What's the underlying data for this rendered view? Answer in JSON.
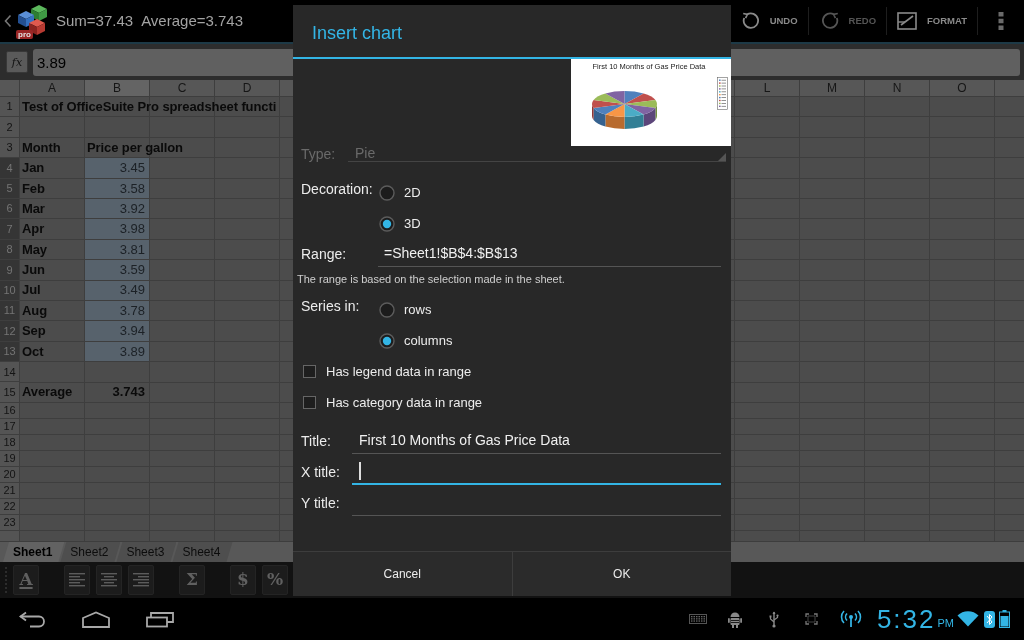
{
  "action_bar": {
    "logo_badge": "pro",
    "sum": "Sum=37.43",
    "average": "Average=3.743",
    "actions": [
      {
        "kind": "undo",
        "label": "UNDO",
        "disabled": false
      },
      {
        "kind": "redo",
        "label": "REDO",
        "disabled": true
      },
      {
        "kind": "format",
        "label": "FORMAT",
        "disabled": false
      }
    ]
  },
  "formula_bar": {
    "function_button": "fx",
    "value": "3.89"
  },
  "sheet": {
    "columns_left": [
      {
        "label": "A",
        "selected": false
      },
      {
        "label": "B",
        "selected": true
      },
      {
        "label": "C",
        "selected": false
      },
      {
        "label": "D",
        "selected": false
      }
    ],
    "columns_right": [
      {
        "label": "L",
        "selected": false
      },
      {
        "label": "M",
        "selected": false
      },
      {
        "label": "N",
        "selected": false
      },
      {
        "label": "O",
        "selected": false
      }
    ],
    "rows": [
      {
        "number": "1",
        "selected": false,
        "cells": [
          {
            "kind": "label",
            "text": "Test of OfficeSuite Pro spreadsheet functi"
          }
        ]
      },
      {
        "number": "2",
        "selected": false
      },
      {
        "number": "3",
        "selected": false,
        "cells": [
          {
            "kind": "label",
            "text": "Month"
          },
          {
            "kind": "label",
            "text": "Price per gallon"
          }
        ]
      },
      {
        "number": "4",
        "selected": true,
        "cells": [
          {
            "kind": "label",
            "text": "Jan"
          },
          {
            "kind": "value",
            "text": "3.45"
          }
        ]
      },
      {
        "number": "5",
        "selected": true,
        "cells": [
          {
            "kind": "label",
            "text": "Feb"
          },
          {
            "kind": "value",
            "text": "3.58"
          }
        ]
      },
      {
        "number": "6",
        "selected": true,
        "cells": [
          {
            "kind": "label",
            "text": "Mar"
          },
          {
            "kind": "value",
            "text": "3.92"
          }
        ]
      },
      {
        "number": "7",
        "selected": true,
        "cells": [
          {
            "kind": "label",
            "text": "Apr"
          },
          {
            "kind": "value",
            "text": "3.98"
          }
        ]
      },
      {
        "number": "8",
        "selected": true,
        "cells": [
          {
            "kind": "label",
            "text": "May"
          },
          {
            "kind": "value",
            "text": "3.81"
          }
        ]
      },
      {
        "number": "9",
        "selected": true,
        "cells": [
          {
            "kind": "label",
            "text": "Jun"
          },
          {
            "kind": "value",
            "text": "3.59"
          }
        ]
      },
      {
        "number": "10",
        "selected": true,
        "cells": [
          {
            "kind": "label",
            "text": "Jul"
          },
          {
            "kind": "value",
            "text": "3.49"
          }
        ]
      },
      {
        "number": "11",
        "selected": true,
        "cells": [
          {
            "kind": "label",
            "text": "Aug"
          },
          {
            "kind": "value",
            "text": "3.78"
          }
        ]
      },
      {
        "number": "12",
        "selected": true,
        "cells": [
          {
            "kind": "label",
            "text": "Sep"
          },
          {
            "kind": "value",
            "text": "3.94"
          }
        ]
      },
      {
        "number": "13",
        "selected": true,
        "cells": [
          {
            "kind": "label",
            "text": "Oct"
          },
          {
            "kind": "value",
            "text": "3.89"
          }
        ]
      },
      {
        "number": "14",
        "selected": false
      },
      {
        "number": "15",
        "selected": false,
        "cells": [
          {
            "kind": "label",
            "text": "Average"
          },
          {
            "kind": "total",
            "text": "3.743"
          }
        ]
      },
      {
        "number": "16",
        "selected": false
      },
      {
        "number": "17",
        "selected": false
      },
      {
        "number": "18",
        "selected": false
      },
      {
        "number": "19",
        "selected": false
      },
      {
        "number": "20",
        "selected": false
      },
      {
        "number": "21",
        "selected": false
      },
      {
        "number": "22",
        "selected": false
      },
      {
        "number": "23",
        "selected": false
      }
    ]
  },
  "sheet_tabs": [
    {
      "label": "Sheet1",
      "selected": true
    },
    {
      "label": "Sheet2",
      "selected": false
    },
    {
      "label": "Sheet3",
      "selected": false
    },
    {
      "label": "Sheet4",
      "selected": false
    }
  ],
  "format_toolbar": [
    {
      "kind": "font",
      "text": "A"
    },
    {
      "kind": "align_left"
    },
    {
      "kind": "align_center"
    },
    {
      "kind": "align_right"
    },
    {
      "kind": "function",
      "text": "Σ"
    },
    {
      "kind": "number_format",
      "text": "$"
    },
    {
      "kind": "number_format",
      "text": "%"
    }
  ],
  "dialog": {
    "title": "Insert chart",
    "preview": {
      "title": "First 10 Months of Gas Price Data"
    },
    "type_field": {
      "label": "Type:",
      "value": "Pie"
    },
    "decoration": {
      "label": "Decoration:",
      "options": [
        {
          "label": "2D",
          "selected": false
        },
        {
          "label": "3D",
          "selected": true
        }
      ]
    },
    "range": {
      "label": "Range:",
      "value": "=Sheet1!$B$4:$B$13",
      "focused": false
    },
    "range_hint": "The range is based on the selection made in the sheet.",
    "series_in": {
      "label": "Series in:",
      "options": [
        {
          "label": "rows",
          "selected": false
        },
        {
          "label": "columns",
          "selected": true
        }
      ]
    },
    "checkboxes": [
      {
        "label": "Has legend data in range",
        "checked": false
      },
      {
        "label": "Has category data in range",
        "checked": false
      }
    ],
    "title_fields": [
      {
        "label": "Title:",
        "value": "First 10 Months of Gas Price Data",
        "focused": false
      },
      {
        "label": "X title:",
        "focused": true
      },
      {
        "label": "Y title:",
        "focused": false
      }
    ],
    "buttons": [
      {
        "label": "Cancel"
      },
      {
        "label": "OK"
      }
    ]
  },
  "status_bar": {
    "time": "5:32",
    "period": "PM"
  }
}
